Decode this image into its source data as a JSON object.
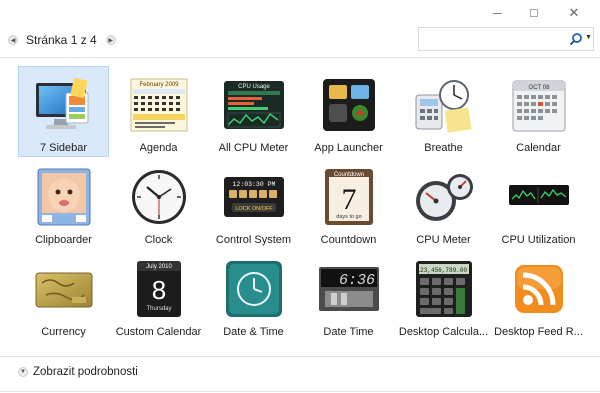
{
  "window": {
    "controls": {
      "minimize_icon": "minimize-icon",
      "maximize_icon": "maximize-icon",
      "close_glyph": "✕"
    }
  },
  "pager": {
    "label": "Stránka 1 z 4",
    "prev_glyph": "◀",
    "next_glyph": "▶"
  },
  "search": {
    "value": "",
    "placeholder": "",
    "icon": "search-icon",
    "dropdown_glyph": "▼"
  },
  "gadgets": [
    {
      "label": "7 Sidebar",
      "icon": "monitor-sidebar-icon",
      "selected": true
    },
    {
      "label": "Agenda",
      "icon": "agenda-calendar-icon",
      "selected": false
    },
    {
      "label": "All CPU Meter",
      "icon": "cpu-meter-panel-icon",
      "selected": false
    },
    {
      "label": "App Launcher",
      "icon": "app-launcher-icon",
      "selected": false
    },
    {
      "label": "Breathe",
      "icon": "breathe-clock-calculator-icon",
      "selected": false
    },
    {
      "label": "Calendar",
      "icon": "calendar-icon",
      "selected": false
    },
    {
      "label": "Clipboarder",
      "icon": "baby-photo-icon",
      "selected": false
    },
    {
      "label": "Clock",
      "icon": "analog-clock-icon",
      "selected": false
    },
    {
      "label": "Control System",
      "icon": "control-system-icon",
      "selected": false
    },
    {
      "label": "Countdown",
      "icon": "countdown-calendar-icon",
      "selected": false
    },
    {
      "label": "CPU Meter",
      "icon": "cpu-gauge-icon",
      "selected": false
    },
    {
      "label": "CPU Utilization",
      "icon": "cpu-graph-icon",
      "selected": false
    },
    {
      "label": "Currency",
      "icon": "currency-card-icon",
      "selected": false
    },
    {
      "label": "Custom Calendar",
      "icon": "custom-calendar-icon",
      "selected": false
    },
    {
      "label": "Date & Time",
      "icon": "teal-clock-icon",
      "selected": false
    },
    {
      "label": "Date Time",
      "icon": "digital-clock-icon",
      "selected": false
    },
    {
      "label": "Desktop Calcula...",
      "icon": "calculator-icon",
      "selected": false
    },
    {
      "label": "Desktop Feed R...",
      "icon": "rss-feed-icon",
      "selected": false
    }
  ],
  "thumb_texts": {
    "agenda_month": "February 2009",
    "cpu_usage": "CPU Usage",
    "control_time": "12:03:30 PM",
    "control_lock": "LOCK ON/OFF",
    "countdown_title": "Countdown",
    "countdown_number": "7",
    "countdown_sub": "days to go",
    "calendar_month": "OCT 08",
    "custom_month": "July 2010",
    "custom_day": "8",
    "custom_weekday": "Thursday",
    "digital_time": "6:36",
    "calc_display": "123,456,789.00"
  },
  "footer": {
    "details_label": "Zobrazit podrobnosti",
    "chevron_glyph": "▼"
  },
  "colors": {
    "selection_bg": "#d9e9f9",
    "selection_border": "#b9d5f2",
    "rss_orange": "#f28c1c",
    "teal_clock": "#2a8d8d"
  }
}
